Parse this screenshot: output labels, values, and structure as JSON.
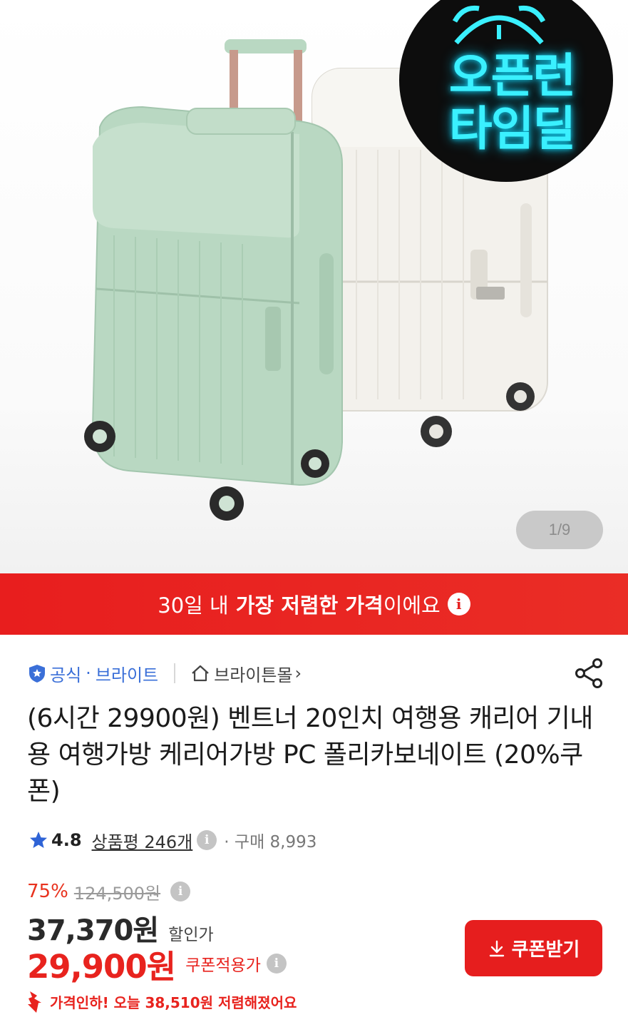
{
  "hero": {
    "badge_line1": "오픈런",
    "badge_line2": "타임딜",
    "image_counter": "1/9"
  },
  "banner": {
    "prefix": "30일 내",
    "highlight": "가장 저렴한 가격",
    "suffix": "이에요",
    "info_icon": "i"
  },
  "seller": {
    "official_label": "공식",
    "separator": "·",
    "brand": "브라이트",
    "mall_name": "브라이튼몰",
    "chevron": "›"
  },
  "product": {
    "title": "(6시간 29900원) 벤트너 20인치 여행용 캐리어 기내용 여행가방 케리어가방 PC 폴리카보네이트 (20%쿠폰)"
  },
  "rating": {
    "score": "4.8",
    "review_label": "상품평 246개",
    "info_icon": "i",
    "purchase_label": "· 구매 8,993"
  },
  "price": {
    "discount_rate": "75%",
    "original_price": "124,500원",
    "sale_price": "37,370원",
    "sale_label": "할인가",
    "coupon_price": "29,900원",
    "coupon_label": "쿠폰적용가",
    "price_drop_text": "가격인하! 오늘 38,510원 저렴해졌어요",
    "info_icon": "i"
  },
  "coupon_button": {
    "label": "쿠폰받기"
  },
  "colors": {
    "accent_red": "#e8231e",
    "brand_blue": "#3a6fd8",
    "badge_cyan": "#3af0ff",
    "suitcase_mint": "#b9d8c2",
    "suitcase_white": "#f3f1ec"
  },
  "icons": [
    "official-shield-icon",
    "home-icon",
    "share-icon",
    "star-icon",
    "info-icon",
    "download-icon",
    "price-down-arrow-icon"
  ]
}
